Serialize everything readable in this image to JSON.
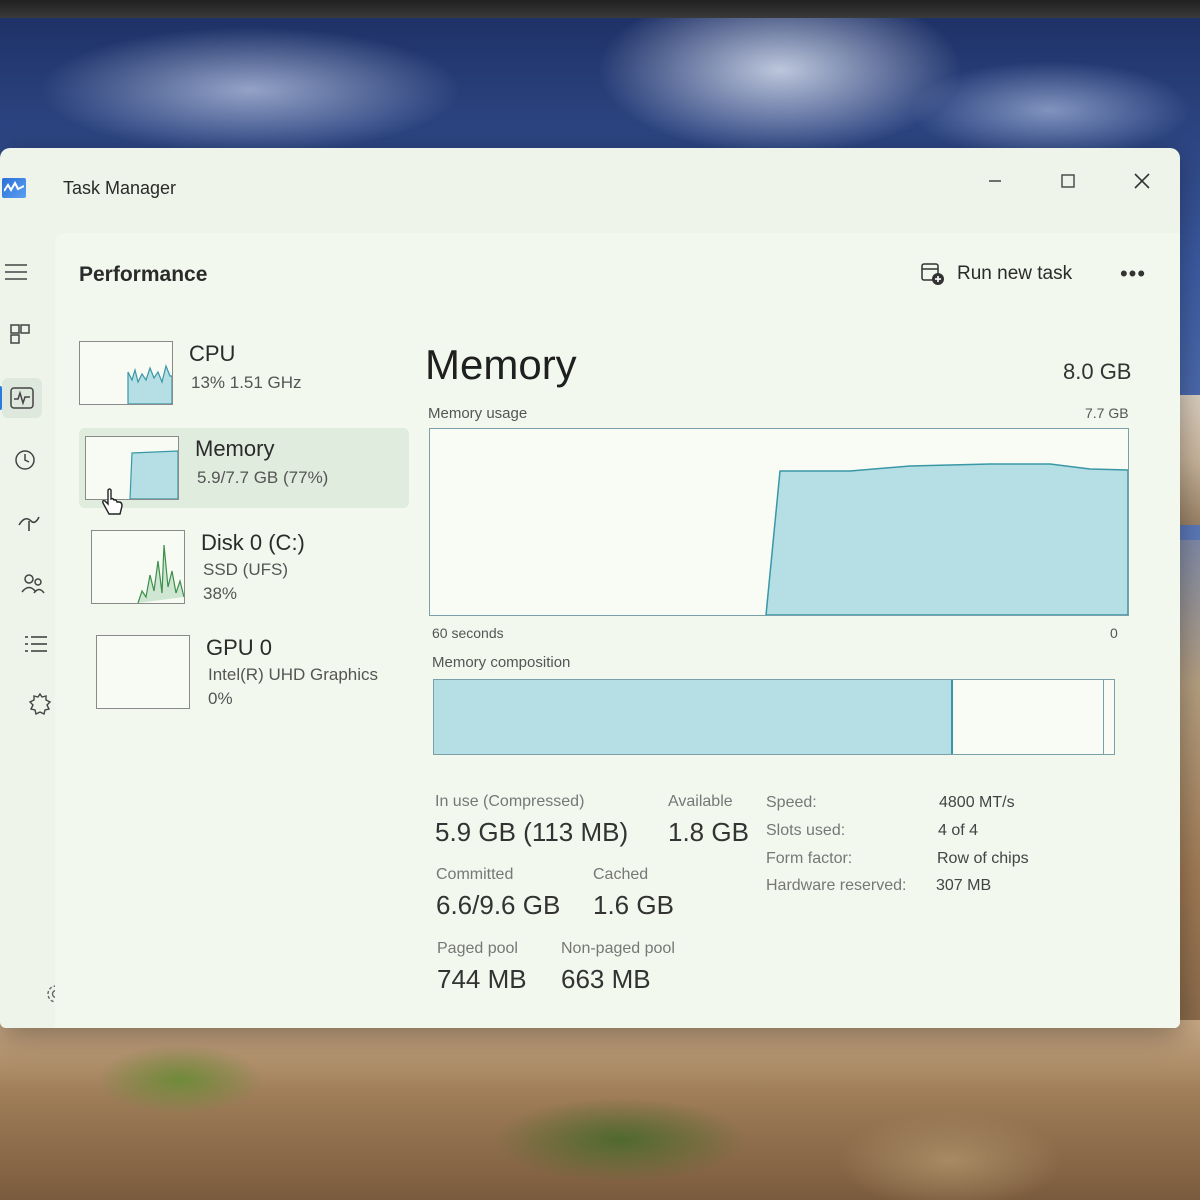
{
  "window": {
    "title": "Task Manager",
    "icon": "task-manager-app-icon",
    "controls": [
      "minimize-icon",
      "maximize-icon",
      "close-icon"
    ]
  },
  "nav": {
    "items": [
      "hamburger-icon",
      "processes-icon",
      "performance-icon",
      "app-history-icon",
      "startup-apps-icon",
      "users-icon",
      "details-icon",
      "services-icon"
    ],
    "active": "performance-icon",
    "settings_icon": "settings-icon"
  },
  "header": {
    "title": "Performance",
    "run_task_label": "Run new task",
    "more_label": "•••"
  },
  "resources": [
    {
      "name": "CPU",
      "line1": "13%  1.51 GHz",
      "line2": ""
    },
    {
      "name": "Memory",
      "line1": "5.9/7.7 GB (77%)",
      "line2": ""
    },
    {
      "name": "Disk 0 (C:)",
      "line1": "SSD (UFS)",
      "line2": "38%"
    },
    {
      "name": "GPU 0",
      "line1": "Intel(R) UHD Graphics",
      "line2": "0%"
    }
  ],
  "memory": {
    "title": "Memory",
    "total": "8.0 GB",
    "usage_label": "Memory usage",
    "usage_max": "7.7 GB",
    "time_left": "60 seconds",
    "time_right": "0",
    "composition_label": "Memory composition",
    "composition": {
      "in_use_fraction": 0.76,
      "standby_fraction": 0.22,
      "free_fraction": 0.02
    },
    "stats": {
      "in_use_label": "In use (Compressed)",
      "in_use_value": "5.9 GB (113 MB)",
      "available_label": "Available",
      "available_value": "1.8 GB",
      "committed_label": "Committed",
      "committed_value": "6.6/9.6 GB",
      "cached_label": "Cached",
      "cached_value": "1.6 GB",
      "paged_label": "Paged pool",
      "paged_value": "744 MB",
      "nonpaged_label": "Non-paged pool",
      "nonpaged_value": "663 MB"
    },
    "specs": {
      "speed_label": "Speed:",
      "speed_value": "4800 MT/s",
      "slots_label": "Slots used:",
      "slots_value": "4 of 4",
      "form_label": "Form factor:",
      "form_value": "Row of chips",
      "reserved_label": "Hardware reserved:",
      "reserved_value": "307 MB"
    }
  },
  "colors": {
    "graph_fill": "#b5dfe4",
    "graph_line": "#3a97a6",
    "accent": "#2a7ae2"
  }
}
